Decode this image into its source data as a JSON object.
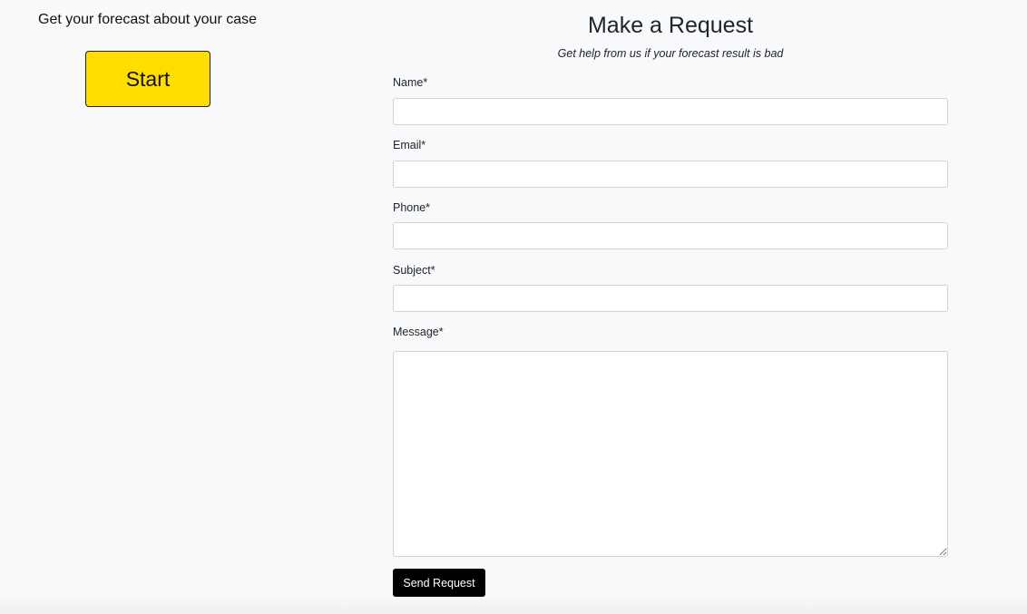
{
  "left_panel": {
    "heading": "Get your forecast about your case",
    "start_label": "Start"
  },
  "request_form": {
    "title": "Make a Request",
    "subtitle": "Get help from us if your forecast result is bad",
    "fields": {
      "name": {
        "label": "Name*",
        "value": "",
        "placeholder": ""
      },
      "email": {
        "label": "Email*",
        "value": "",
        "placeholder": ""
      },
      "phone": {
        "label": "Phone*",
        "value": "",
        "placeholder": ""
      },
      "subject": {
        "label": "Subject*",
        "value": "",
        "placeholder": ""
      },
      "message": {
        "label": "Message*",
        "value": "",
        "placeholder": ""
      }
    },
    "submit_label": "Send Request"
  },
  "colors": {
    "page_background": "#f8f9fa",
    "start_button": "#ffdd00",
    "send_button": "#000000",
    "input_border": "#ced4da"
  }
}
